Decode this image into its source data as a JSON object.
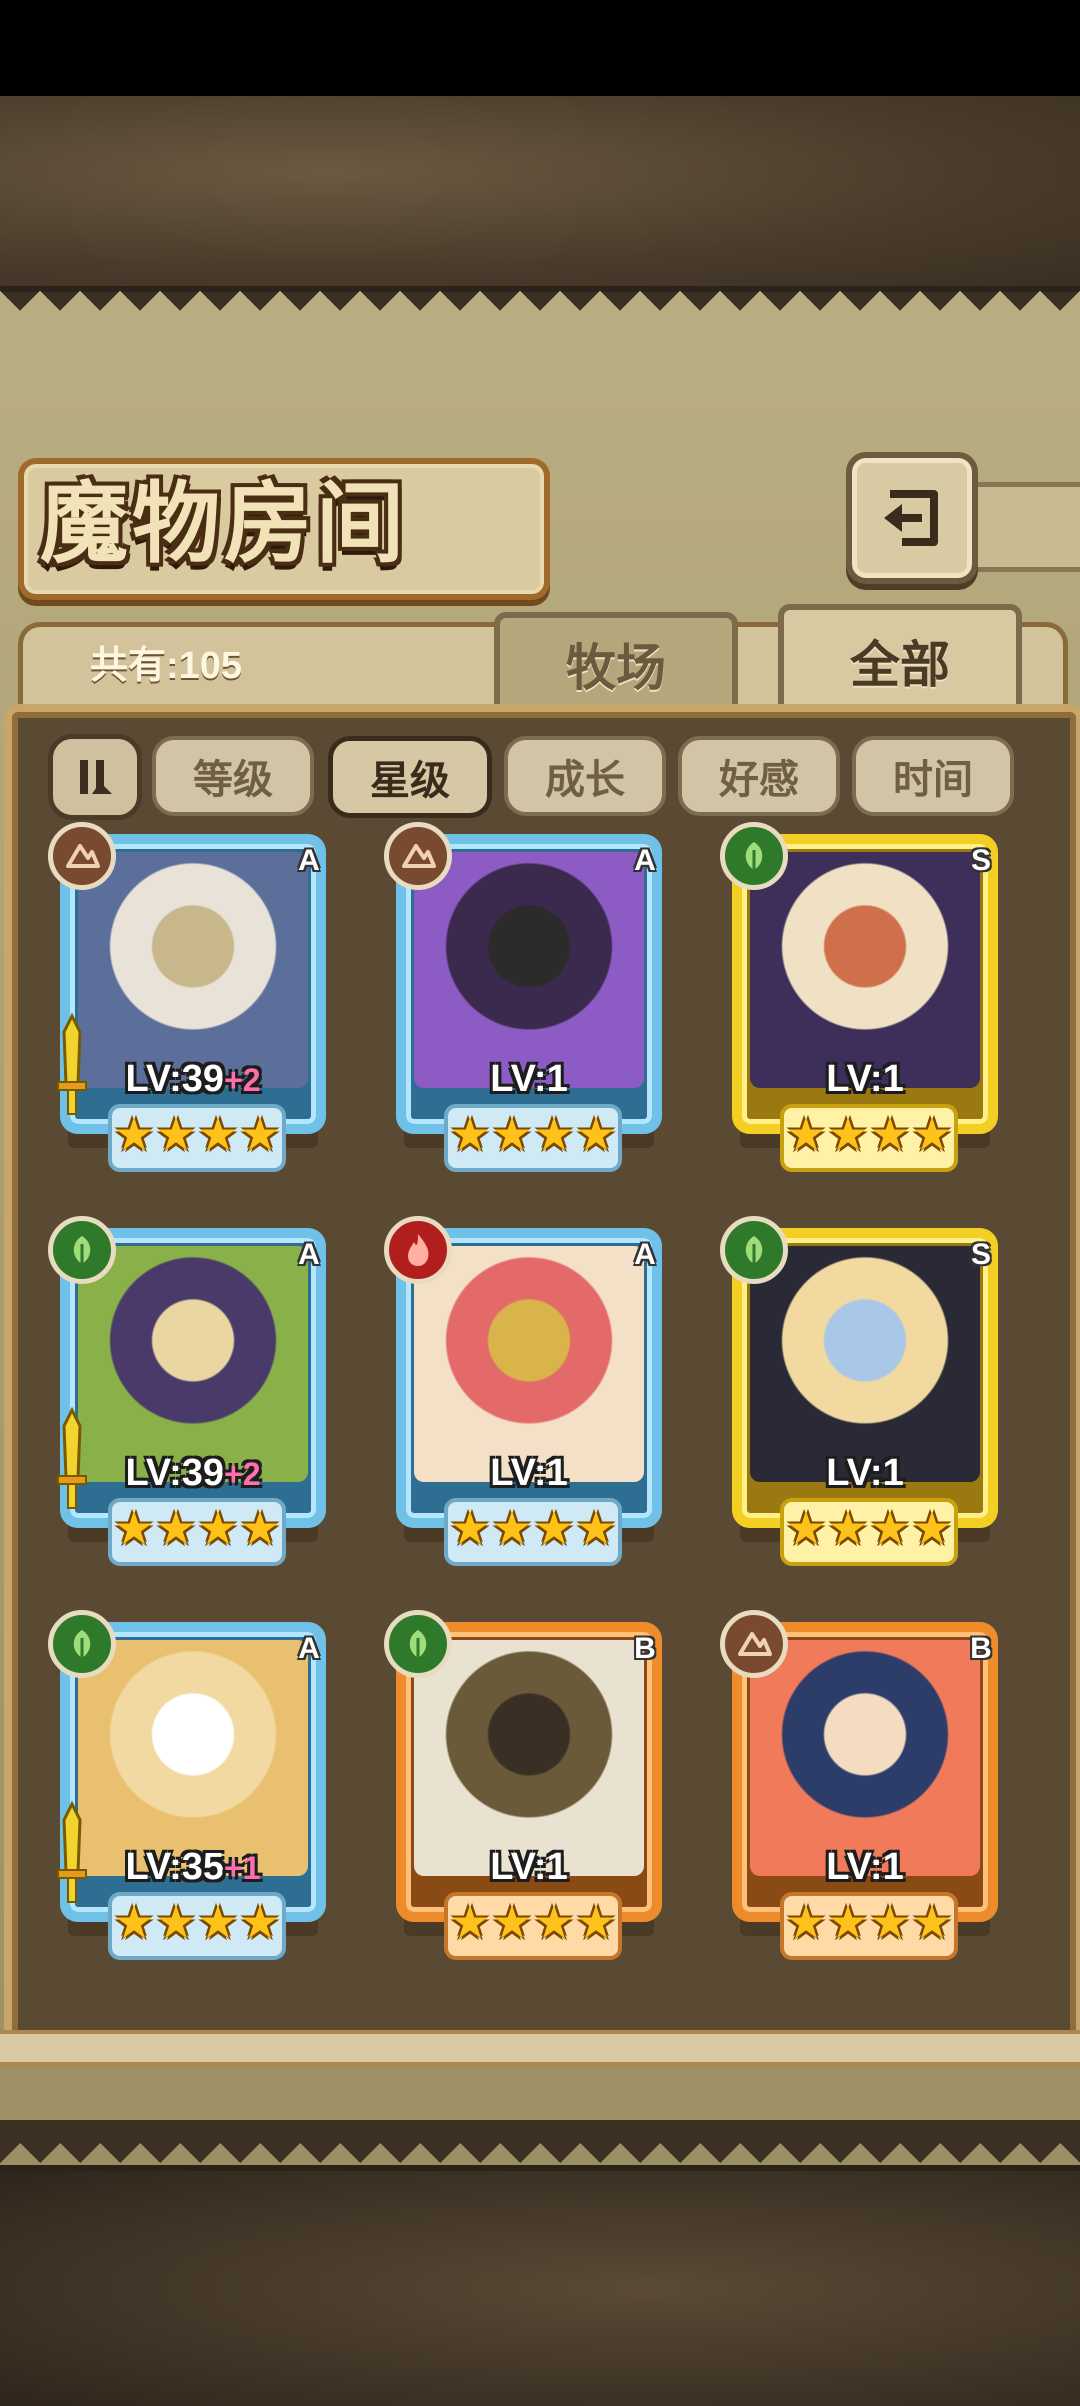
{
  "header": {
    "title": "魔物房间",
    "back_icon": "back-arrow-icon"
  },
  "tabs": {
    "count_label": "共有:105",
    "ranch": "牧场",
    "all": "全部",
    "active": "全部"
  },
  "sort": {
    "toggle_icon": "sort-order-icon",
    "buttons": [
      "等级",
      "星级",
      "成长",
      "好感",
      "时间"
    ],
    "active": "星级"
  },
  "cards": [
    {
      "element": "earth",
      "rank": "A",
      "level": "LV:39",
      "plus": "+2",
      "stars": 4,
      "weapon": true,
      "frame": "blue",
      "palette": [
        "#e9e2d8",
        "#5b6f9a",
        "#c8b78a"
      ]
    },
    {
      "element": "earth",
      "rank": "A",
      "level": "LV:1",
      "plus": "",
      "stars": 4,
      "weapon": false,
      "frame": "blue",
      "palette": [
        "#3b2a4e",
        "#8d5bc4",
        "#2b2b2b"
      ]
    },
    {
      "element": "grass",
      "rank": "S",
      "level": "LV:1",
      "plus": "",
      "stars": 4,
      "weapon": false,
      "frame": "gold",
      "palette": [
        "#f0e1c4",
        "#3e2f5a",
        "#d0704a"
      ]
    },
    {
      "element": "grass",
      "rank": "A",
      "level": "LV:39",
      "plus": "+2",
      "stars": 4,
      "weapon": true,
      "frame": "blue",
      "palette": [
        "#4a3a6a",
        "#8ab04a",
        "#e9d6a0"
      ]
    },
    {
      "element": "fire",
      "rank": "A",
      "level": "LV:1",
      "plus": "",
      "stars": 4,
      "weapon": false,
      "frame": "blue",
      "palette": [
        "#e46a6a",
        "#f3e0c6",
        "#d8b44a"
      ]
    },
    {
      "element": "grass",
      "rank": "S",
      "level": "LV:1",
      "plus": "",
      "stars": 4,
      "weapon": false,
      "frame": "gold",
      "palette": [
        "#f1d9a0",
        "#2a2a36",
        "#a9c8e8"
      ]
    },
    {
      "element": "grass",
      "rank": "A",
      "level": "LV:35",
      "plus": "+1",
      "stars": 4,
      "weapon": true,
      "frame": "blue",
      "palette": [
        "#f2d9a2",
        "#e8c070",
        "#ffffff"
      ]
    },
    {
      "element": "grass",
      "rank": "B",
      "level": "LV:1",
      "plus": "",
      "stars": 4,
      "weapon": false,
      "frame": "orange",
      "palette": [
        "#6a5a3a",
        "#e9e2d0",
        "#3a2f24"
      ]
    },
    {
      "element": "earth",
      "rank": "B",
      "level": "LV:1",
      "plus": "",
      "stars": 4,
      "weapon": false,
      "frame": "orange",
      "palette": [
        "#2c3d6a",
        "#f07a5a",
        "#f4dcc0"
      ]
    }
  ]
}
